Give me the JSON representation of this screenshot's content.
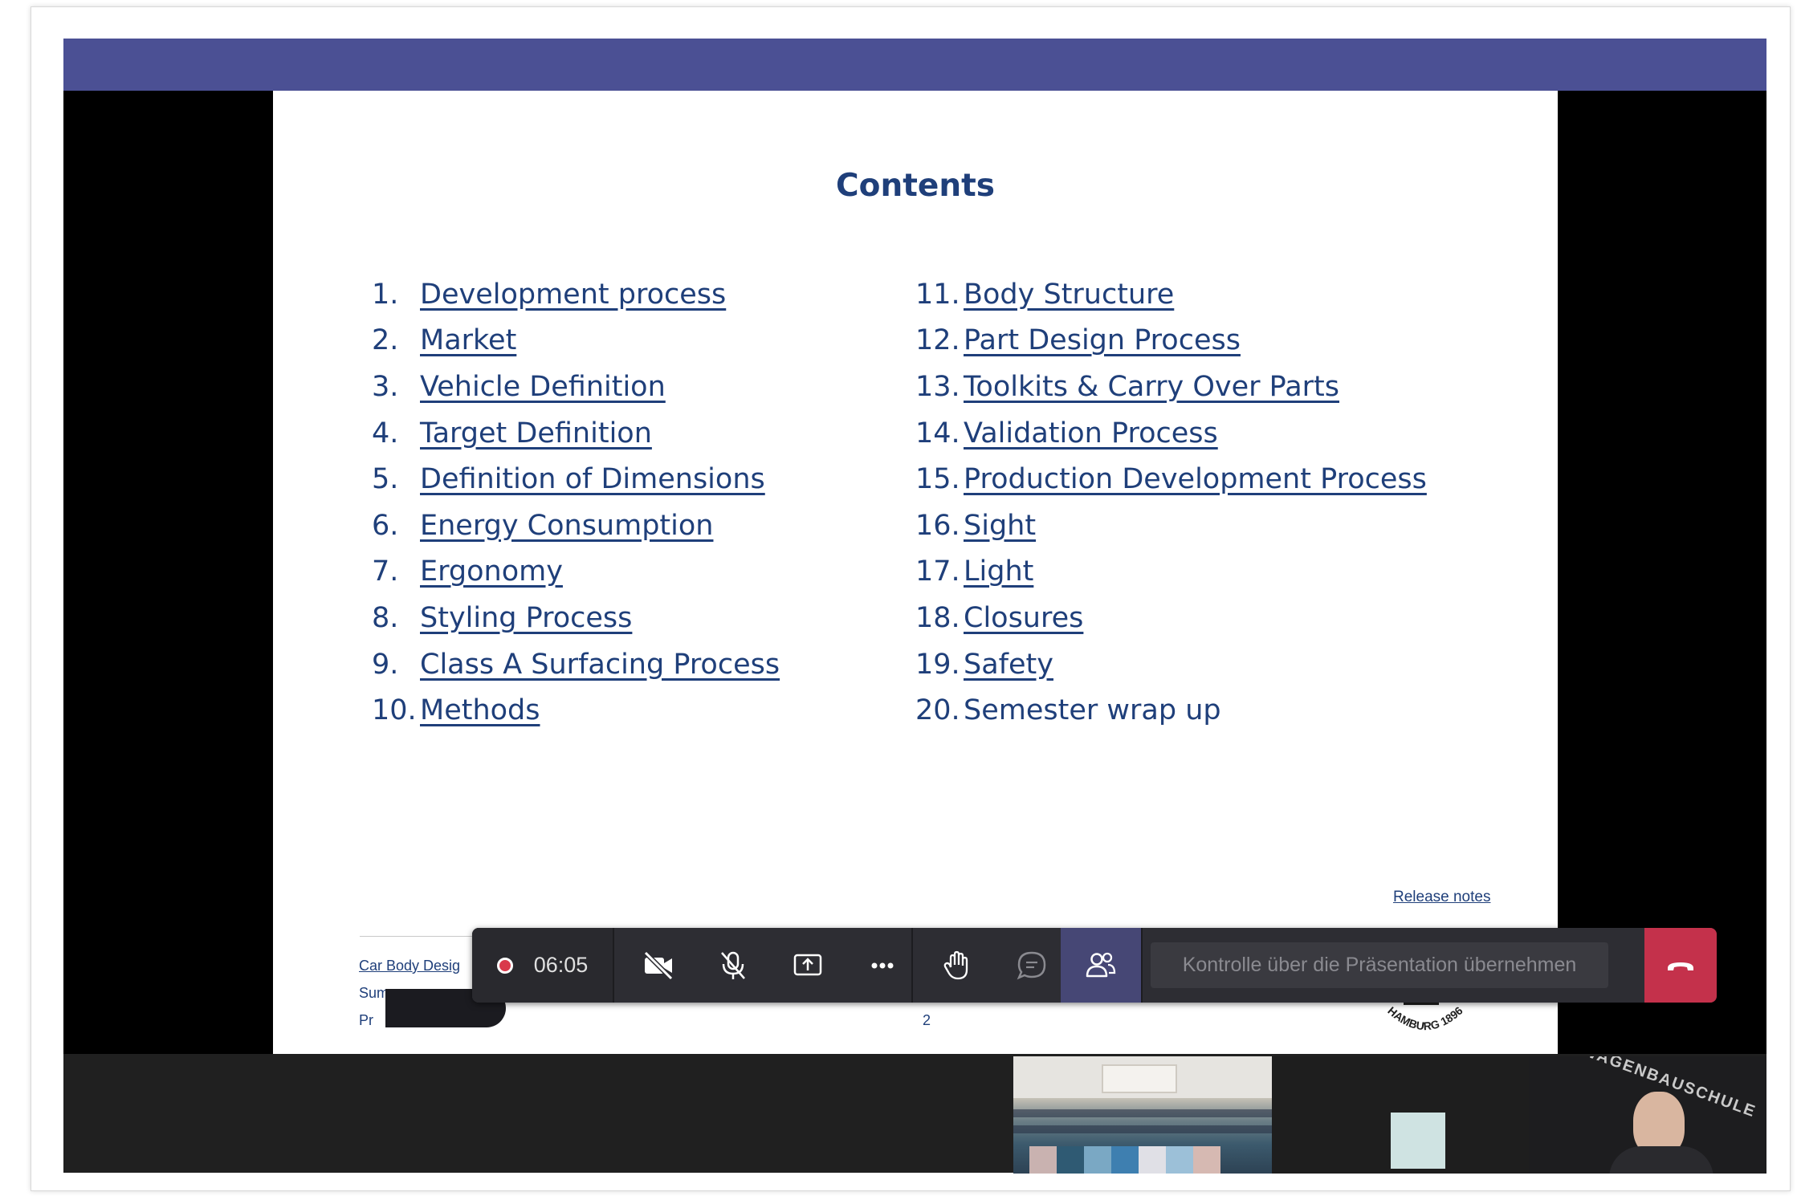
{
  "slide": {
    "title": "Contents",
    "left_items": [
      {
        "num": "1.",
        "label": "Development process",
        "linked": true
      },
      {
        "num": "2.",
        "label": "Market",
        "linked": true
      },
      {
        "num": "3.",
        "label": "Vehicle Definition",
        "linked": true
      },
      {
        "num": "4.",
        "label": "Target Definition",
        "linked": true
      },
      {
        "num": "5.",
        "label": "Definition of Dimensions",
        "linked": true
      },
      {
        "num": "6.",
        "label": "Energy Consumption",
        "linked": true
      },
      {
        "num": "7.",
        "label": "Ergonomy",
        "linked": true
      },
      {
        "num": "8.",
        "label": "Styling Process",
        "linked": true
      },
      {
        "num": "9.",
        "label": "Class A Surfacing Process",
        "linked": true
      },
      {
        "num": "10.",
        "label": "Methods",
        "linked": true
      }
    ],
    "right_items": [
      {
        "num": "11.",
        "label": "Body Structure",
        "linked": true
      },
      {
        "num": "12.",
        "label": "Part Design Process",
        "linked": true
      },
      {
        "num": "13.",
        "label": "Toolkits & Carry Over Parts",
        "linked": true
      },
      {
        "num": "14.",
        "label": "Validation Process",
        "linked": true
      },
      {
        "num": "15.",
        "label": "Production Development Process",
        "linked": true
      },
      {
        "num": "16.",
        "label": "Sight",
        "linked": true
      },
      {
        "num": "17.",
        "label": "Light",
        "linked": true
      },
      {
        "num": "18.",
        "label": "Closures",
        "linked": true
      },
      {
        "num": "19.",
        "label": "Safety",
        "linked": true
      },
      {
        "num": "20.",
        "label": "Semester wrap up",
        "linked": false
      }
    ],
    "release_notes": "Release notes",
    "footer_line1": "Car Body Desig",
    "footer_line2": "Sum",
    "footer_line3": "Pr",
    "page_number": "2",
    "logo_text": "HAMBURG 1896"
  },
  "toolbar": {
    "recording_time": "06:05",
    "control_request": "Kontrolle über die Präsentation übernehmen",
    "icons": [
      "camera-off-icon",
      "mic-off-icon",
      "share-screen-icon",
      "more-icon",
      "raise-hand-icon",
      "chat-icon",
      "participants-icon",
      "hang-up-icon"
    ]
  },
  "participants": {
    "speaker_background_text": "WAGENBAUSCHULE"
  },
  "colors": {
    "title_bar": "#4b5094",
    "slide_text": "#1f3f7a",
    "toolbar_bg": "#2d2d33",
    "participants_active": "#464775",
    "hang_up": "#c4314b",
    "recording": "#d9394b"
  }
}
